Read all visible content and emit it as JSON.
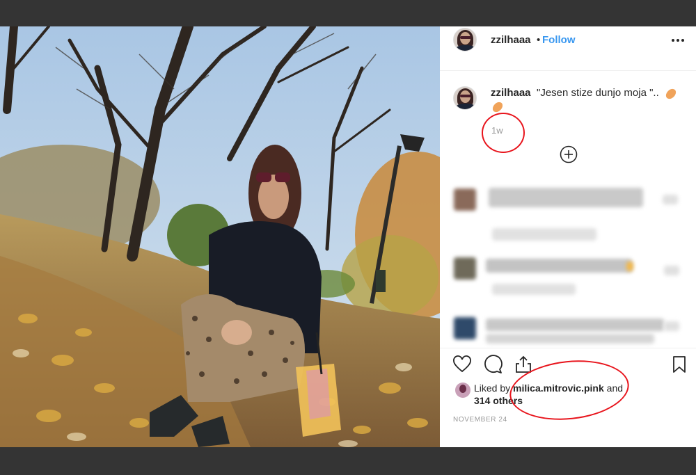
{
  "post": {
    "username": "zzilhaaa",
    "separator": "•",
    "follow_label": "Follow",
    "more_icon": "more-horizontal-icon",
    "caption_text": "\"Jesen stize dunjo moja \"..",
    "time_ago": "1w",
    "load_more_icon": "plus-circle-icon",
    "liked_by_prefix": "Liked by ",
    "liked_by_user": "milica.mitrovic.pink",
    "liked_by_suffix": " and",
    "likes_count": "314 others",
    "date": "NOVEMBER 24"
  },
  "actions": {
    "like_icon": "heart-icon",
    "comment_icon": "comment-icon",
    "share_icon": "share-icon",
    "save_icon": "bookmark-icon"
  },
  "colors": {
    "link_blue": "#3897f0",
    "text_dark": "#262626",
    "muted": "#9a9a9a",
    "annotation_red": "#e8141c",
    "outer_background": "#343434"
  }
}
